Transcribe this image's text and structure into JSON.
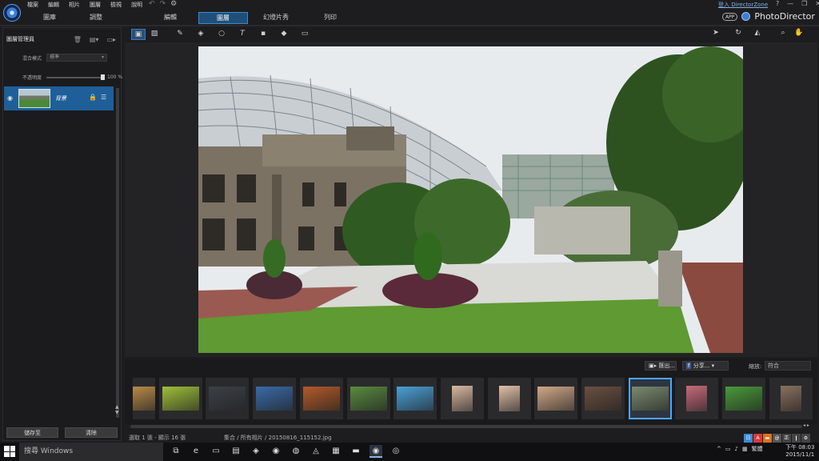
{
  "menu": [
    "檔案",
    "編輯",
    "相片",
    "圖層",
    "檢視",
    "說明"
  ],
  "undo_icons": [
    "undo-icon",
    "redo-icon",
    "settings-gear-icon"
  ],
  "login_link": "登入 DirectorZone",
  "window_controls": [
    "?",
    "—",
    "❐",
    "✕"
  ],
  "brand": {
    "app_badge": "APP",
    "name": "PhotoDirector"
  },
  "mode_tabs": [
    {
      "label": "圖庫",
      "active": false
    },
    {
      "label": "調整",
      "active": false
    },
    {
      "label": "編輯",
      "active": false
    },
    {
      "label": "圖層",
      "active": true
    },
    {
      "label": "幻燈片秀",
      "active": false
    },
    {
      "label": "列印",
      "active": false
    }
  ],
  "layer_panel": {
    "title": "圖層管理員",
    "blend_label": "混合模式",
    "blend_value": "標準",
    "opacity_label": "不透明度",
    "opacity_value": "100 %",
    "layer_name": "背景",
    "save_as": "儲存至",
    "clear": "清除"
  },
  "toolbar_icons": [
    "layer-thumb-icon",
    "image-icon",
    "brush-icon",
    "eraser-icon",
    "ellipse-icon",
    "text-icon",
    "dot-icon",
    "fill-icon",
    "frame-icon"
  ],
  "toolbar_right_icons": [
    "select-arrow-icon",
    "rotate-icon",
    "flip-icon",
    "zoom-icon",
    "hand-icon"
  ],
  "filmstrip": {
    "export_label": "匯出...",
    "share_label": "分享...",
    "zoom_label": "縮放:",
    "zoom_value": "符合",
    "thumbnails": [
      {
        "kind": "land",
        "color": "#b88a4a"
      },
      {
        "kind": "land",
        "color": "#9fbf3a"
      },
      {
        "kind": "land",
        "color": "#3c4048"
      },
      {
        "kind": "land",
        "color": "#3a6aa8"
      },
      {
        "kind": "land",
        "color": "#b35a2a"
      },
      {
        "kind": "land",
        "color": "#5a8a40"
      },
      {
        "kind": "land",
        "color": "#4aa0d8"
      },
      {
        "kind": "port",
        "color": "#d8b8a0"
      },
      {
        "kind": "port",
        "color": "#e0c0a8"
      },
      {
        "kind": "land",
        "color": "#d0a888"
      },
      {
        "kind": "land",
        "color": "#6a5040"
      },
      {
        "kind": "land",
        "color": "#7a8a70",
        "selected": true
      },
      {
        "kind": "port",
        "color": "#c86a7a"
      },
      {
        "kind": "land",
        "color": "#4a9a3a"
      },
      {
        "kind": "port",
        "color": "#8a7060"
      }
    ]
  },
  "status": {
    "selection": "選取 1 張 - 顯示 16 張",
    "path": "集合 / 所有相片 / 20150816_115152.jpg"
  },
  "tray_badges": [
    {
      "t": "日",
      "c": "#3a8ad8"
    },
    {
      "t": "A",
      "c": "#d83a3a"
    },
    {
      "t": "▬",
      "c": "#e07020"
    },
    {
      "t": "@",
      "c": "#555"
    },
    {
      "t": "正",
      "c": "#444"
    },
    {
      "t": "❙",
      "c": "#444"
    },
    {
      "t": "⚙",
      "c": "#444"
    }
  ],
  "taskbar": {
    "search_placeholder": "搜尋 Windows",
    "apps": [
      {
        "icon": "task-view-icon",
        "g": "⧉"
      },
      {
        "icon": "edge-browser-icon",
        "g": "e"
      },
      {
        "icon": "file-explorer-icon",
        "g": "▭"
      },
      {
        "icon": "store-icon",
        "g": "▤"
      },
      {
        "icon": "unity-icon",
        "g": "◈"
      },
      {
        "icon": "firefox-icon",
        "g": "◉"
      },
      {
        "icon": "chrome-icon",
        "g": "◍"
      },
      {
        "icon": "media-icon",
        "g": "◬"
      },
      {
        "icon": "notepad-icon",
        "g": "▦"
      },
      {
        "icon": "camera-app-icon",
        "g": "▬"
      },
      {
        "icon": "photodirector-icon",
        "g": "◉",
        "running": true
      },
      {
        "icon": "cyberlink-icon",
        "g": "◎"
      }
    ],
    "tray": [
      "^",
      "▭",
      "♪",
      "▦",
      "繁體"
    ],
    "clock_period": "下午 08:03",
    "clock_date": "2015/11/1"
  }
}
